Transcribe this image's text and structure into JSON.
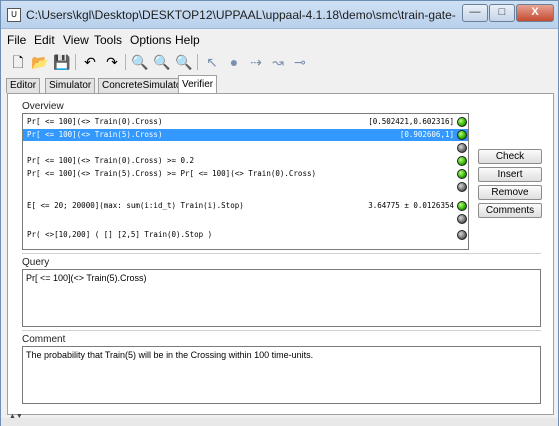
{
  "window": {
    "title": "C:\\Users\\kgl\\Desktop\\DESKTOP12\\UPPAAL\\uppaal-4.1.18\\demo\\smc\\train-gate-stat.xml - UPP...",
    "app_icon": "uppaal-icon",
    "controls": {
      "minimize": "—",
      "maximize": "□",
      "close": "X"
    }
  },
  "menu": {
    "items": [
      {
        "label": "File"
      },
      {
        "label": "Edit"
      },
      {
        "label": "View"
      },
      {
        "label": "Tools"
      },
      {
        "label": "Options"
      },
      {
        "label": "Help"
      }
    ]
  },
  "toolbar": {
    "icons": [
      "new-file-icon",
      "open-folder-icon",
      "save-icon",
      "undo-icon",
      "redo-icon",
      "zoom-icon",
      "zoom-in-icon",
      "zoom-out-icon",
      "select-arrow-icon",
      "add-location-icon",
      "add-edge-icon",
      "add-nail-icon",
      "add-branch-icon"
    ]
  },
  "tabs": [
    {
      "label": "Editor"
    },
    {
      "label": "Simulator"
    },
    {
      "label": "ConcreteSimulator"
    },
    {
      "label": "Verifier"
    }
  ],
  "overview": {
    "label": "Overview",
    "rows": [
      {
        "query": "Pr[ <= 100](<> Train(0).Cross)",
        "result": "[0.502421,0.602316]",
        "status": "green"
      },
      {
        "query": "Pr[ <= 100](<> Train(5).Cross)",
        "result": "[0.902606,1]",
        "status": "green",
        "selected": true
      },
      {
        "query": "",
        "result": "",
        "status": "grey"
      },
      {
        "query": "Pr[ <= 100](<> Train(0).Cross) >= 0.2",
        "result": "",
        "status": "green"
      },
      {
        "query": "Pr[ <= 100](<> Train(5).Cross) >= Pr[ <= 100](<> Train(0).Cross)",
        "result": "",
        "status": "green"
      },
      {
        "query": "",
        "result": "",
        "status": "grey"
      },
      {
        "query": "E[ <= 20; 20000](max: sum(i:id_t) Train(i).Stop)",
        "result": "3.64775 ± 0.0126354",
        "status": "green"
      },
      {
        "query": "",
        "result": "",
        "status": "grey"
      },
      {
        "query": "Pr( <>[10,200] ( [] [2,5] Train(0).Stop )",
        "result": "",
        "status": "grey"
      }
    ]
  },
  "buttons": {
    "check": "Check",
    "insert": "Insert",
    "remove": "Remove",
    "comments": "Comments"
  },
  "query": {
    "label": "Query",
    "value": "Pr[ <= 100](<> Train(5).Cross)"
  },
  "comment": {
    "label": "Comment",
    "value": "The probability that Train(5) will be in the Crossing within 100 time-units."
  }
}
